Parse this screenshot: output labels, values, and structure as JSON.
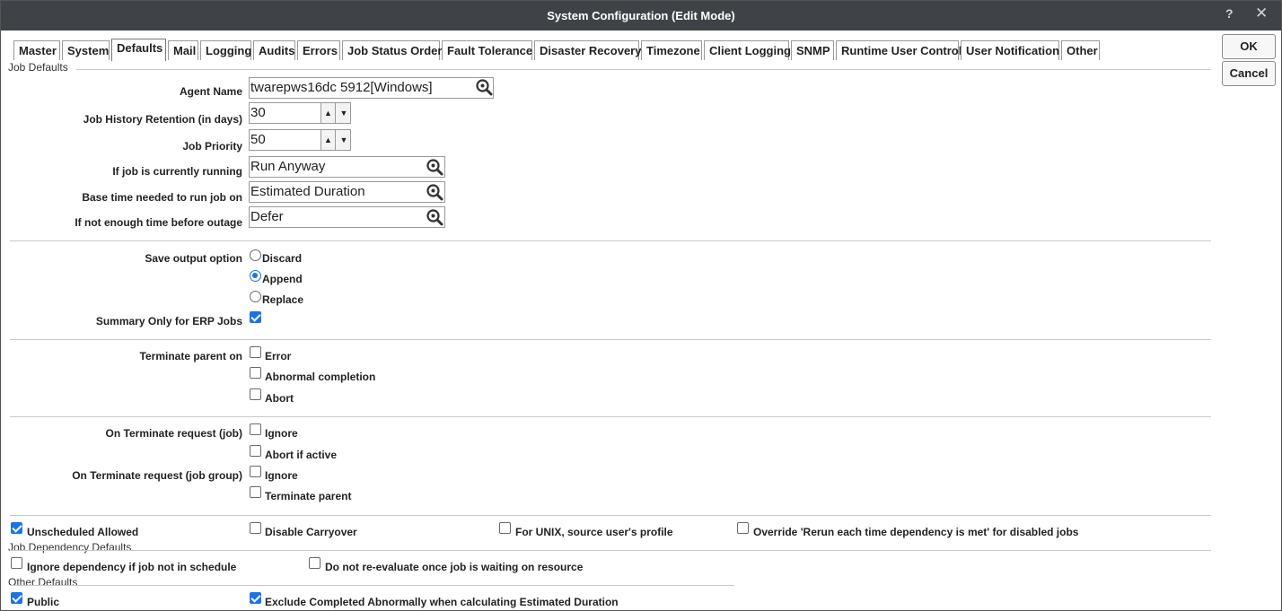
{
  "window": {
    "title": "System Configuration (Edit Mode)",
    "help_glyph": "?",
    "close_glyph": "✕"
  },
  "tabs": [
    "Master",
    "System",
    "Defaults",
    "Mail",
    "Logging",
    "Audits",
    "Errors",
    "Job Status Order",
    "Fault Tolerance",
    "Disaster Recovery",
    "Timezone",
    "Client Logging",
    "SNMP",
    "Runtime User Control",
    "User Notification",
    "Other"
  ],
  "active_tab": "Defaults",
  "buttons": {
    "ok": "OK",
    "cancel": "Cancel"
  },
  "job_defaults": {
    "section_title": "Job Defaults",
    "agent_name": {
      "label": "Agent Name",
      "value": "twarepws16dc 5912[Windows]"
    },
    "history_retention": {
      "label": "Job History Retention (in days)",
      "value": "30"
    },
    "job_priority": {
      "label": "Job Priority",
      "value": "50"
    },
    "if_running": {
      "label": "If job is currently running",
      "value": "Run Anyway"
    },
    "base_time": {
      "label": "Base time needed to run job on",
      "value": "Estimated Duration"
    },
    "not_enough_time": {
      "label": "If not enough time before outage",
      "value": "Defer"
    }
  },
  "save_output": {
    "label": "Save output option",
    "options": [
      "Discard",
      "Append",
      "Replace"
    ],
    "selected": "Append"
  },
  "summary_only": {
    "label": "Summary Only for ERP Jobs",
    "checked": true
  },
  "terminate_parent": {
    "label": "Terminate parent on",
    "options": [
      {
        "label": "Error",
        "checked": false
      },
      {
        "label": "Abnormal completion",
        "checked": false
      },
      {
        "label": "Abort",
        "checked": false
      }
    ]
  },
  "terminate_job": {
    "label": "On Terminate request (job)",
    "options": [
      {
        "label": "Ignore",
        "checked": false
      },
      {
        "label": "Abort if active",
        "checked": false
      }
    ]
  },
  "terminate_group": {
    "label": "On Terminate request (job group)",
    "options": [
      {
        "label": "Ignore",
        "checked": false
      },
      {
        "label": "Terminate parent",
        "checked": false
      }
    ]
  },
  "misc": {
    "unscheduled_allowed": {
      "label": "Unscheduled Allowed",
      "checked": true
    },
    "disable_carryover": {
      "label": "Disable Carryover",
      "checked": false
    },
    "unix_profile": {
      "label": "For UNIX, source user's profile",
      "checked": false
    },
    "override_rerun": {
      "label": "Override 'Rerun each time dependency is met' for disabled jobs",
      "checked": false
    }
  },
  "dependency_defaults": {
    "section_title": "Job Dependency Defaults",
    "ignore_dependency": {
      "label": "Ignore dependency if job not in schedule",
      "checked": false
    },
    "no_reevaluate": {
      "label": "Do not re-evaluate once job is waiting on resource",
      "checked": false
    }
  },
  "other_defaults": {
    "section_title": "Other Defaults",
    "public": {
      "label": "Public",
      "checked": true
    },
    "exclude_abnormal": {
      "label": "Exclude Completed Abnormally when calculating Estimated Duration",
      "checked": true
    }
  },
  "colors": {
    "titlebar": "#3f4347",
    "accent": "#1a73e8"
  },
  "icons": {
    "lookup": "magnifier-icon",
    "spin_up": "▲",
    "spin_down": "▼"
  }
}
